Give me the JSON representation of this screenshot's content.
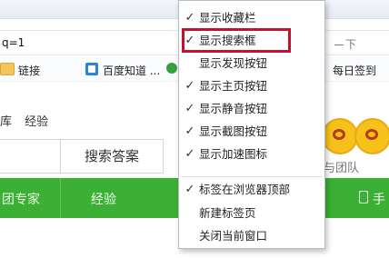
{
  "browser": {
    "address_text": "q=1",
    "address_right_text": "下",
    "bookmarks": [
      {
        "label": "链接",
        "icon": "folder-icon"
      },
      {
        "label": "百度知道 ...",
        "icon": "baidu-zhidao-icon"
      },
      {
        "label": "每日签到",
        "icon": "green-circle-icon"
      }
    ]
  },
  "page": {
    "links": [
      "库",
      "经验"
    ],
    "search_button": "搜索答案",
    "nav": [
      "团专家",
      "经验",
      "手"
    ],
    "mascot_text": "戏与团队"
  },
  "menu": {
    "items": [
      {
        "label": "显示收藏栏",
        "checked": true
      },
      {
        "label": "显示搜索框",
        "checked": true,
        "highlighted": true
      },
      {
        "label": "显示发现按钮",
        "checked": false
      },
      {
        "label": "显示主页按钮",
        "checked": true
      },
      {
        "label": "显示静音按钮",
        "checked": true
      },
      {
        "label": "显示截图按钮",
        "checked": true
      },
      {
        "label": "显示加速图标",
        "checked": true
      },
      {
        "label": "标签在浏览器顶部",
        "checked": true
      },
      {
        "label": "新建标签页",
        "checked": false
      },
      {
        "label": "关闭当前窗口",
        "checked": false
      }
    ],
    "check_glyph": "✓"
  },
  "colors": {
    "accent_green": "#3cb035",
    "highlight_red": "#c8102e"
  }
}
